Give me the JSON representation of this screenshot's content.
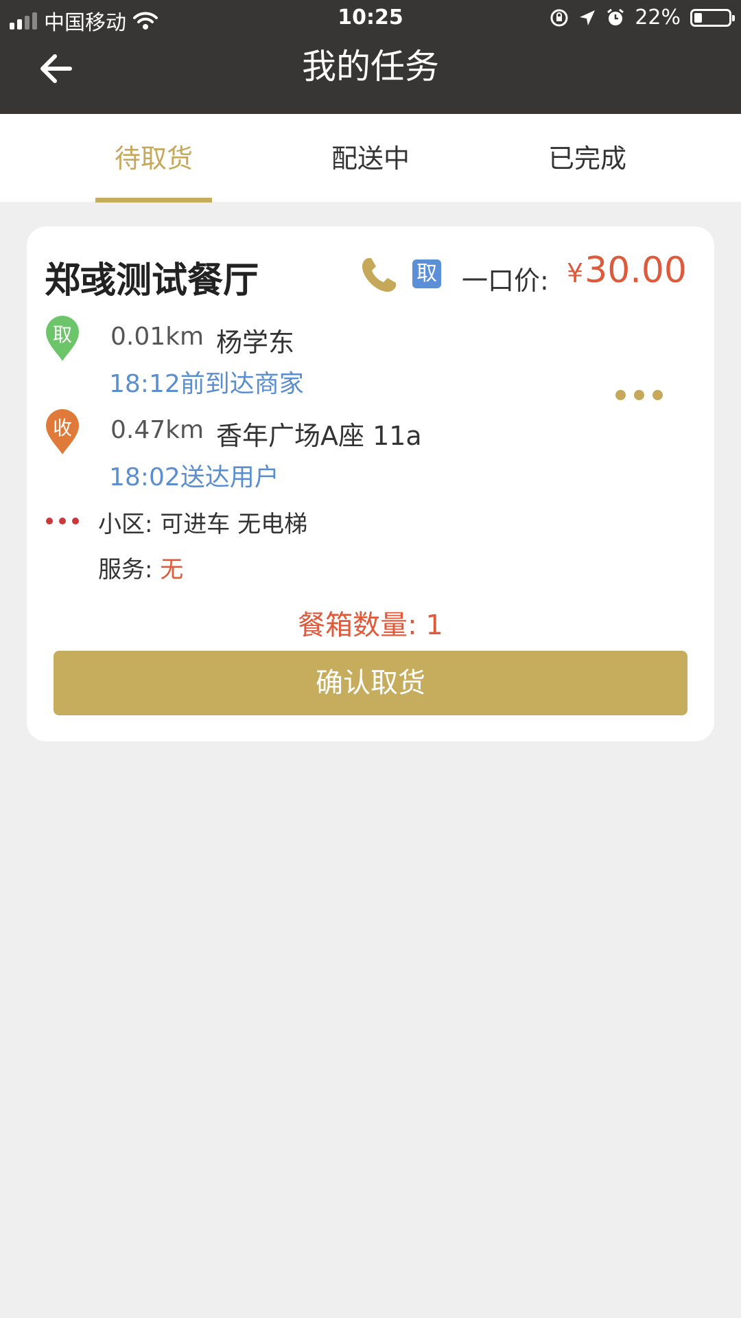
{
  "status_bar": {
    "carrier": "中国移动",
    "time": "10:25",
    "battery_percent": "22%",
    "battery_level": 0.22
  },
  "header": {
    "title": "我的任务"
  },
  "tabs": [
    {
      "label": "待取货",
      "active": true
    },
    {
      "label": "配送中",
      "active": false
    },
    {
      "label": "已完成",
      "active": false
    }
  ],
  "task": {
    "shop_name": "郑彧测试餐厅",
    "pickup_badge": "取",
    "price_label": "一口价:",
    "price_currency": "¥",
    "price_value": "30.00",
    "pickup": {
      "marker": "取",
      "distance": "0.01km",
      "name": "杨学东",
      "time_note": "18:12前到达商家"
    },
    "delivery": {
      "marker": "收",
      "distance": "0.47km",
      "address": "香年广场A座 11a",
      "time_note": "18:02送达用户"
    },
    "community_label": "小区:",
    "community_value": "可进车 无电梯",
    "service_label": "服务:",
    "service_value": "无",
    "box_count_label": "餐箱数量:",
    "box_count_value": "1",
    "confirm_label": "确认取货"
  },
  "colors": {
    "header_bg": "#383634",
    "accent_gold": "#c5a85a",
    "price_red": "#dd5b3c",
    "link_blue": "#5a8ecf",
    "pickup_green": "#6dc56a",
    "delivery_orange": "#e07a3a"
  },
  "icons": [
    "signal-icon",
    "wifi-icon",
    "orientation-lock-icon",
    "location-arrow-icon",
    "alarm-icon",
    "battery-icon",
    "back-arrow-icon",
    "phone-icon",
    "pickup-marker-icon",
    "delivery-marker-icon",
    "more-icon"
  ]
}
